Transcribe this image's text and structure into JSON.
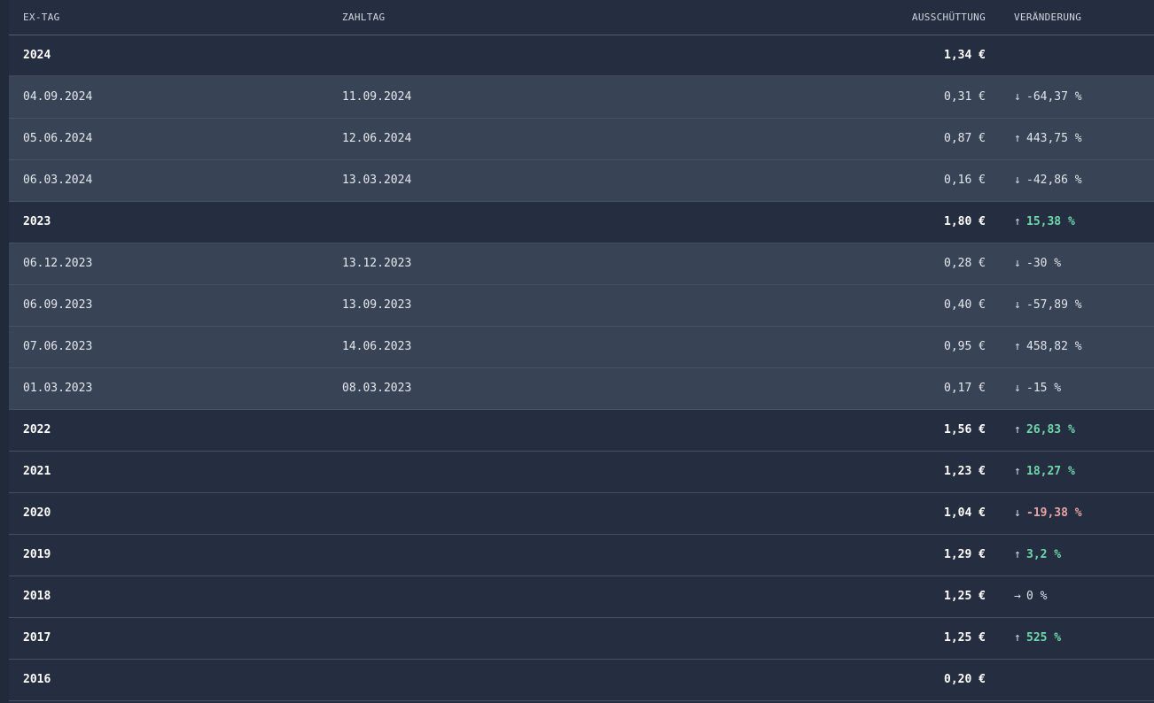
{
  "table": {
    "headers": {
      "ex_tag": "EX-TAG",
      "zahltag": "ZAHLTAG",
      "ausschuettung": "AUSSCHÜTTUNG",
      "veraenderung": "VERÄNDERUNG"
    },
    "rows": [
      {
        "type": "year",
        "ex": "2024",
        "pay": "",
        "amount": "1,34 €",
        "arrow": "",
        "change": "",
        "tone": "neutral"
      },
      {
        "type": "detail",
        "ex": "04.09.2024",
        "pay": "11.09.2024",
        "amount": "0,31 €",
        "arrow": "↓",
        "change": "-64,37 %",
        "tone": "neutral"
      },
      {
        "type": "detail",
        "ex": "05.06.2024",
        "pay": "12.06.2024",
        "amount": "0,87 €",
        "arrow": "↑",
        "change": "443,75 %",
        "tone": "neutral"
      },
      {
        "type": "detail",
        "ex": "06.03.2024",
        "pay": "13.03.2024",
        "amount": "0,16 €",
        "arrow": "↓",
        "change": "-42,86 %",
        "tone": "neutral"
      },
      {
        "type": "year",
        "ex": "2023",
        "pay": "",
        "amount": "1,80 €",
        "arrow": "↑",
        "change": "15,38 %",
        "tone": "up-green"
      },
      {
        "type": "detail",
        "ex": "06.12.2023",
        "pay": "13.12.2023",
        "amount": "0,28 €",
        "arrow": "↓",
        "change": "-30 %",
        "tone": "neutral"
      },
      {
        "type": "detail",
        "ex": "06.09.2023",
        "pay": "13.09.2023",
        "amount": "0,40 €",
        "arrow": "↓",
        "change": "-57,89 %",
        "tone": "neutral"
      },
      {
        "type": "detail",
        "ex": "07.06.2023",
        "pay": "14.06.2023",
        "amount": "0,95 €",
        "arrow": "↑",
        "change": "458,82 %",
        "tone": "neutral"
      },
      {
        "type": "detail",
        "ex": "01.03.2023",
        "pay": "08.03.2023",
        "amount": "0,17 €",
        "arrow": "↓",
        "change": "-15 %",
        "tone": "neutral"
      },
      {
        "type": "year",
        "ex": "2022",
        "pay": "",
        "amount": "1,56 €",
        "arrow": "↑",
        "change": "26,83 %",
        "tone": "up-green"
      },
      {
        "type": "year",
        "ex": "2021",
        "pay": "",
        "amount": "1,23 €",
        "arrow": "↑",
        "change": "18,27 %",
        "tone": "up-green"
      },
      {
        "type": "year",
        "ex": "2020",
        "pay": "",
        "amount": "1,04 €",
        "arrow": "↓",
        "change": "-19,38 %",
        "tone": "down-red"
      },
      {
        "type": "year",
        "ex": "2019",
        "pay": "",
        "amount": "1,29 €",
        "arrow": "↑",
        "change": "3,2 %",
        "tone": "up-green"
      },
      {
        "type": "year",
        "ex": "2018",
        "pay": "",
        "amount": "1,25 €",
        "arrow": "→",
        "change": "0 %",
        "tone": "neutral"
      },
      {
        "type": "year",
        "ex": "2017",
        "pay": "",
        "amount": "1,25 €",
        "arrow": "↑",
        "change": "525 %",
        "tone": "up-green"
      },
      {
        "type": "year",
        "ex": "2016",
        "pay": "",
        "amount": "0,20 €",
        "arrow": "",
        "change": "",
        "tone": "neutral"
      }
    ]
  }
}
